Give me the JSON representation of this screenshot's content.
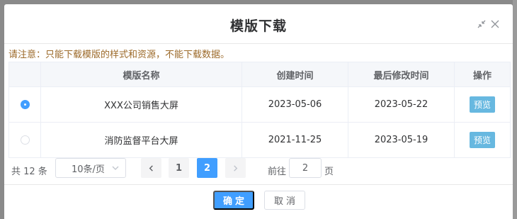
{
  "dialog": {
    "title": "模版下载",
    "notice": "请注意：只能下载模版的样式和资源，不能下载数据。"
  },
  "table": {
    "columns": [
      "",
      "模版名称",
      "创建时间",
      "最后修改时间",
      "操作"
    ],
    "rows": [
      {
        "selected": true,
        "name": "XXX公司销售大屏",
        "created": "2023-05-06",
        "modified": "2023-05-22",
        "action": "预览"
      },
      {
        "selected": false,
        "name": "消防监督平台大屏",
        "created": "2021-11-25",
        "modified": "2023-05-19",
        "action": "预览"
      }
    ]
  },
  "pager": {
    "total": "共 12 条",
    "page_size": "10条/页",
    "pages": [
      "1",
      "2"
    ],
    "current": "2",
    "goto_label": "前往",
    "goto_value": "2",
    "goto_suffix": "页"
  },
  "footer": {
    "ok_label": "确定",
    "cancel_label": "取消"
  },
  "colors": {
    "primary": "#409eff",
    "preview": "#67b8e0",
    "notice": "#9c6a2a"
  }
}
